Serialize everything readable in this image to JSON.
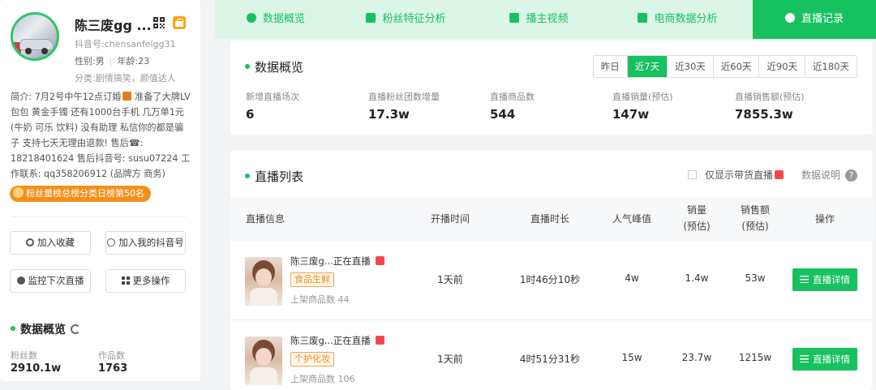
{
  "profile": {
    "nickname": "陈三废gg ...",
    "douyin_id": "抖音号:chensanfeigg31",
    "gender": "性别:男",
    "age": "年龄:23",
    "category": "分类:剧情搞笑，颜值达人",
    "intro_parts": [
      "简介: 7月2号中午12点订婚",
      " 准备了大牌LV包包 黄金手镯 还有1000台手机 几万单1元(牛奶 可乐 饮料) 没有助理 私信你的都是骗子 支持七天无理由退款!  售后☎: 18218401624 售后抖音号: susu07224 工作联系: qq358206912 (品牌方 商务)"
    ],
    "rank_badge": "粉丝量榜总榜分类日榜第50名"
  },
  "actions": {
    "add_favorite": "加入收藏",
    "add_my_douyin": "加入我的抖音号",
    "monitor_next_live": "监控下次直播",
    "more_actions": "更多操作"
  },
  "left_overview": {
    "title": "数据概览",
    "fans_label": "粉丝数",
    "fans_value": "2910.1w",
    "works_label": "作品数",
    "works_value": "1763"
  },
  "tabs": [
    "数据概览",
    "粉丝特征分析",
    "播主视频",
    "电商数据分析",
    "直播记录"
  ],
  "overview": {
    "title": "数据概览",
    "ranges": [
      "昨日",
      "近7天",
      "近30天",
      "近60天",
      "近90天",
      "近180天"
    ],
    "active_range": "近7天",
    "stats": [
      {
        "label": "新增直播场次",
        "value": "6"
      },
      {
        "label": "直播粉丝团数增量",
        "value": "17.3w"
      },
      {
        "label": "直播商品数",
        "value": "544"
      },
      {
        "label": "直播销量(预估)",
        "value": "147w"
      },
      {
        "label": "直播销售额(预估)",
        "value": "7855.3w"
      }
    ]
  },
  "live_list": {
    "title": "直播列表",
    "only_goods_label": "仅显示带货直播",
    "data_explain": "数据说明",
    "columns": {
      "info": "直播信息",
      "start_time": "开播时间",
      "duration": "直播时长",
      "peak": "人气峰值",
      "sales_line1": "销量",
      "sales_line2": "(预估)",
      "revenue_line1": "销售额",
      "revenue_line2": "(预估)",
      "action": "操作"
    },
    "rows": [
      {
        "name": "陈三废g...正在直播",
        "tag": "食品生鲜",
        "goods": "上架商品数 44",
        "start": "1天前",
        "duration": "1时46分10秒",
        "peak": "4w",
        "sales": "1.4w",
        "revenue": "53w",
        "detail": "直播详情"
      },
      {
        "name": "陈三废g...正在直播",
        "tag": "个护化妆",
        "goods": "上架商品数 106",
        "start": "1天前",
        "duration": "4时51分31秒",
        "peak": "15w",
        "sales": "23.7w",
        "revenue": "1215w",
        "detail": "直播详情"
      }
    ]
  }
}
